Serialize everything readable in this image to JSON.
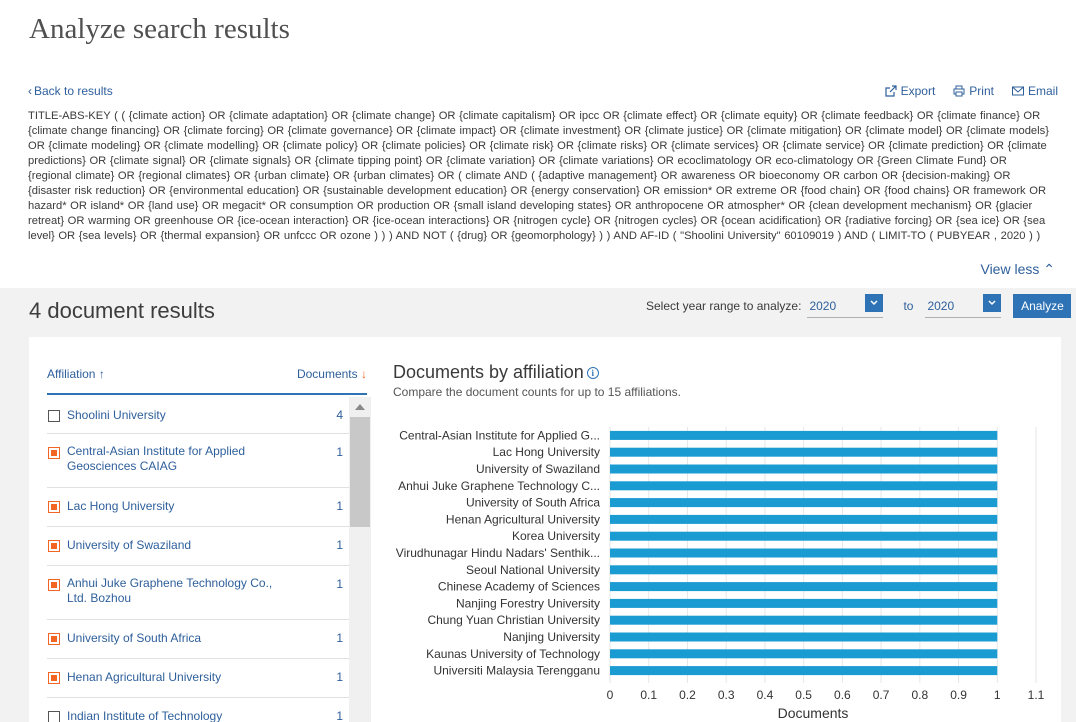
{
  "page": {
    "title": "Analyze search results"
  },
  "nav": {
    "back_label": "Back to results"
  },
  "actions": {
    "export": "Export",
    "print": "Print",
    "email": "Email"
  },
  "query": {
    "text": "TITLE-ABS-KEY ( ( {climate action}  OR  {climate adaptation}  OR  {climate change}  OR  {climate capitalism}  OR  ipcc  OR  {climate effect}  OR  {climate equity}  OR  {climate feedback}  OR  {climate finance}  OR  {climate change financing}  OR  {climate forcing}  OR  {climate governance}  OR  {climate impact}  OR  {climate investment}  OR  {climate justice}  OR  {climate mitigation}  OR  {climate model}  OR  {climate models}  OR  {climate modeling}  OR  {climate modelling}  OR  {climate policy}  OR  {climate policies}  OR  {climate risk}  OR  {climate risks}  OR  {climate services}  OR  {climate service}  OR  {climate prediction}  OR  {climate predictions}  OR  {climate signal}  OR  {climate signals}  OR  {climate tipping point}  OR  {climate variation}  OR  {climate variations}  OR  ecoclimatology  OR  eco-climatology  OR  {Green Climate Fund}  OR  {regional climate}  OR  {regional climates}  OR  {urban climate}  OR  {urban climates}  OR  ( climate  AND  ( {adaptive management}  OR  awareness  OR  bioeconomy  OR  carbon  OR  {decision-making}  OR  {disaster risk reduction}  OR  {environmental education}  OR  {sustainable development education}  OR  {energy conservation}  OR  emission*  OR  extreme  OR  {food chain}  OR  {food chains}  OR  framework  OR  hazard*  OR  island*  OR  {land use}  OR  megacit*  OR  consumption  OR  production  OR  {small island developing states}  OR  anthropocene  OR  atmospher*  OR  {clean development mechanism}  OR  {glacier retreat}  OR  warming  OR  greenhouse  OR  {ice-ocean interaction}  OR  {ice-ocean interactions}  OR  {nitrogen cycle}  OR  {nitrogen cycles}  OR  {ocean acidification}  OR  {radiative forcing}  OR  {sea ice}  OR  {sea level}  OR  {sea levels}  OR  {thermal expansion}  OR  unfccc  OR  ozone ) ) )  AND NOT  ( {drug}  OR  {geomorphology} ) )  AND  AF-ID ( \"Shoolini University\"   60109019 )  AND  ( LIMIT-TO ( PUBYEAR ,  2020 ) )",
    "view_less": "View less"
  },
  "results": {
    "count_label": "4 document results"
  },
  "year_range": {
    "label": "Select year range to analyze:",
    "from": "2020",
    "to_label": "to",
    "to": "2020",
    "analyze": "Analyze"
  },
  "affiliation_table": {
    "col_affiliation": "Affiliation",
    "col_documents": "Documents",
    "rows": [
      {
        "name": "Shoolini University",
        "count": "4",
        "checked": false
      },
      {
        "name": "Central-Asian Institute for Applied Geosciences CAIAG",
        "count": "1",
        "checked": true
      },
      {
        "name": "Lac Hong University",
        "count": "1",
        "checked": true
      },
      {
        "name": "University of Swaziland",
        "count": "1",
        "checked": true
      },
      {
        "name": "Anhui Juke Graphene Technology Co., Ltd. Bozhou",
        "count": "1",
        "checked": true
      },
      {
        "name": "University of South Africa",
        "count": "1",
        "checked": true
      },
      {
        "name": "Henan Agricultural University",
        "count": "1",
        "checked": true
      },
      {
        "name": "Indian Institute of Technology",
        "count": "1",
        "checked": false
      }
    ]
  },
  "chart_panel": {
    "title": "Documents by affiliation",
    "subtitle": "Compare the document counts for up to 15 affiliations."
  },
  "chart_data": {
    "type": "bar",
    "orientation": "horizontal",
    "categories": [
      "Central-Asian Institute for Applied G...",
      "Lac Hong University",
      "University of Swaziland",
      "Anhui Juke Graphene Technology C...",
      "University of South Africa",
      "Henan Agricultural University",
      "Korea University",
      "Virudhunagar Hindu Nadars' Senthik...",
      "Seoul National University",
      "Chinese Academy of Sciences",
      "Nanjing Forestry University",
      "Chung Yuan Christian University",
      "Nanjing University",
      "Kaunas University of Technology",
      "Universiti Malaysia Terengganu"
    ],
    "values": [
      1,
      1,
      1,
      1,
      1,
      1,
      1,
      1,
      1,
      1,
      1,
      1,
      1,
      1,
      1
    ],
    "xlabel": "Documents",
    "xlim": [
      0,
      1.1
    ],
    "xticks": [
      "0",
      "0.1",
      "0.2",
      "0.3",
      "0.4",
      "0.5",
      "0.6",
      "0.7",
      "0.8",
      "0.9",
      "1",
      "1.1"
    ],
    "bar_color": "#1a9bd1",
    "grid": "vertical"
  },
  "colors": {
    "link": "#2e5f9b",
    "accent": "#2e73b5",
    "checkbox": "#f26522"
  }
}
